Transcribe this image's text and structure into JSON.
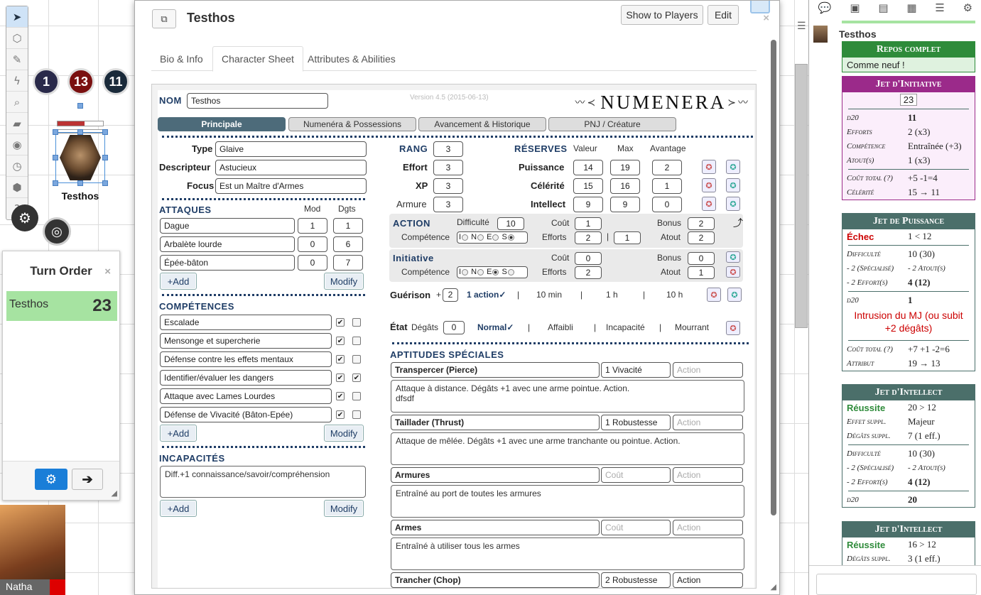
{
  "toolbar_icons": [
    "select-icon",
    "cube-icon",
    "brush-icon",
    "lightning-icon",
    "magnifier-icon",
    "ruler-icon",
    "eye-icon",
    "clock-icon",
    "d20-icon",
    "help-icon"
  ],
  "token": {
    "name": "Testhos",
    "badges": [
      "1",
      "13",
      "11"
    ],
    "badge_colors": [
      "#2a2a4a",
      "#7a1010",
      "#1a2a3a"
    ]
  },
  "turn_order": {
    "title": "Turn Order",
    "close": "×",
    "entries": [
      {
        "name": "Testhos",
        "value": "23"
      }
    ]
  },
  "player": {
    "name": "Natha"
  },
  "dialog": {
    "title": "Testhos",
    "show_players": "Show to Players",
    "edit": "Edit",
    "close": "×",
    "tabs": [
      "Bio & Info",
      "Character Sheet",
      "Attributes & Abilities"
    ]
  },
  "sheet": {
    "nom_label": "NOM",
    "nom_value": "Testhos",
    "version": "Version 4.5 (2015-06-13)",
    "logo": "NUMENERA",
    "subtabs": [
      "Principale",
      "Numenéra & Possessions",
      "Avancement & Historique",
      "PNJ / Créature"
    ],
    "type_label": "Type",
    "type_value": "Glaive",
    "desc_label": "Descripteur",
    "desc_value": "Astucieux",
    "focus_label": "Focus",
    "focus_value": "Est un Maître d'Armes",
    "rang_label": "RANG",
    "rang_value": "3",
    "effort_label": "Effort",
    "effort_value": "3",
    "xp_label": "XP",
    "xp_value": "3",
    "armure_label": "Armure",
    "armure_value": "3",
    "reserves_label": "RÉSERVES",
    "col_valeur": "Valeur",
    "col_max": "Max",
    "col_avantage": "Avantage",
    "pools": [
      {
        "name": "Puissance",
        "valeur": "14",
        "max": "19",
        "avantage": "2"
      },
      {
        "name": "Célérité",
        "valeur": "15",
        "max": "16",
        "avantage": "1"
      },
      {
        "name": "Intellect",
        "valeur": "9",
        "max": "9",
        "avantage": "0"
      }
    ],
    "attaques_label": "ATTAQUES",
    "mod_label": "Mod",
    "dgts_label": "Dgts",
    "attaques": [
      {
        "name": "Dague",
        "mod": "1",
        "dgts": "1"
      },
      {
        "name": "Arbalète lourde",
        "mod": "0",
        "dgts": "6"
      },
      {
        "name": "Épée-bâton",
        "mod": "0",
        "dgts": "7"
      }
    ],
    "add": "+Add",
    "modify": "Modify",
    "action": {
      "label": "ACTION",
      "difficulte_label": "Difficulté",
      "difficulte": "10",
      "cout_label": "Coût",
      "cout": "1",
      "bonus_label": "Bonus",
      "bonus": "2",
      "competence_label": "Compétence",
      "efforts_label": "Efforts",
      "efforts": "2",
      "efforts2": "1",
      "atout_label": "Atout",
      "atout": "2",
      "radio": [
        "I",
        "N",
        "E",
        "S"
      ]
    },
    "initiative": {
      "label": "Initiative",
      "cout_label": "Coût",
      "cout": "0",
      "bonus_label": "Bonus",
      "bonus": "0",
      "competence_label": "Compétence",
      "efforts_label": "Efforts",
      "efforts": "2",
      "atout_label": "Atout",
      "atout": "1",
      "radio": [
        "I",
        "N",
        "E",
        "S"
      ]
    },
    "guerison": {
      "label": "Guérison",
      "plus": "+",
      "value": "2",
      "options": [
        "1 action✓",
        "10 min",
        "1 h",
        "10 h"
      ]
    },
    "etat": {
      "label": "État",
      "degats_label": "Dégâts",
      "degats": "0",
      "options": [
        "Normal✓",
        "Affaibli",
        "Incapacité",
        "Mourrant"
      ]
    },
    "competences_label": "COMPÉTENCES",
    "competences": [
      {
        "name": "Escalade",
        "c1": "✔",
        "c2": ""
      },
      {
        "name": "Mensonge et supercherie",
        "c1": "✔",
        "c2": ""
      },
      {
        "name": "Défense contre les effets mentaux",
        "c1": "✔",
        "c2": ""
      },
      {
        "name": "Identifier/évaluer les dangers",
        "c1": "✔",
        "c2": "✔"
      },
      {
        "name": "Attaque avec Lames Lourdes",
        "c1": "✔",
        "c2": ""
      },
      {
        "name": "Défense de Vivacité (Bâton-Epée)",
        "c1": "✔",
        "c2": ""
      }
    ],
    "incapacites_label": "INCAPACITÉS",
    "incapacites": "Diff.+1 connaissance/savoir/compréhension",
    "aptitudes_label": "APTITUDES SPÉCIALES",
    "aptitudes": [
      {
        "name": "Transpercer (Pierce)",
        "cout": "1 Vivacité",
        "action": "",
        "desc": "Attaque à distance. Dégâts +1 avec une arme pointue. Action.\ndfsdf"
      },
      {
        "name": "Taillader (Thrust)",
        "cout": "1 Robustesse",
        "action": "",
        "desc": "Attaque de mêlée. Dégâts +1 avec une arme tranchante ou pointue. Action."
      },
      {
        "name": "Armures",
        "cout": "",
        "action": "",
        "desc": "Entraîné au port de toutes les armures"
      },
      {
        "name": "Armes",
        "cout": "",
        "action": "",
        "desc": "Entraîné à utiliser tous les armes"
      },
      {
        "name": "Trancher (Chop)",
        "cout": "2 Robustesse",
        "action": "Action",
        "desc": ""
      }
    ],
    "ph_cout": "Coût",
    "ph_action": "Action"
  },
  "chat": {
    "sender": "Testhos",
    "repos": {
      "title": "Repos complet",
      "text": "Comme neuf !",
      "color": "#2e8b3a"
    },
    "initiative": {
      "title": "Jet d'Initiative",
      "total": "23",
      "rows": [
        [
          "d20",
          "11"
        ],
        [
          "Efforts",
          "2 (x3)"
        ],
        [
          "Compétence",
          "Entraînée (+3)"
        ],
        [
          "Atout(s)",
          "1 (x3)"
        ]
      ],
      "rows2": [
        [
          "Coût total (?)",
          "+5 -1=4"
        ],
        [
          "Célérité",
          "15 → 11"
        ]
      ],
      "color": "#9b2a8a"
    },
    "puissance": {
      "title": "Jet de Puissance",
      "result": "Échec",
      "result_val": "1 < 12",
      "rows": [
        [
          "Difficulté",
          "10 (30)"
        ],
        [
          "- 2 (Spécialisé)",
          "- 2 Atout(s)"
        ],
        [
          "- 2 Effort(s)",
          "4 (12)"
        ]
      ],
      "d20": "1",
      "intrusion": "Intrusion du MJ (ou subit +2 dégâts)",
      "rows2": [
        [
          "Coût total (?)",
          "+7 +1 -2=6"
        ],
        [
          "Attribut",
          "19 → 13"
        ]
      ],
      "color": "#4b6f6a"
    },
    "intellect1": {
      "title": "Jet d'Intellect",
      "result": "Réussite",
      "result_val": "20 > 12",
      "rows": [
        [
          "Effet suppl.",
          "Majeur"
        ],
        [
          "Dégâts suppl.",
          "7 (1 eff.)"
        ]
      ],
      "rows2": [
        [
          "Difficulté",
          "10 (30)"
        ],
        [
          "- 2 (Spécialisé)",
          "- 2 Atout(s)"
        ],
        [
          "- 2 Effort(s)",
          "4 (12)"
        ]
      ],
      "d20": "20",
      "color": "#4b6f6a"
    },
    "intellect2": {
      "title": "Jet d'Intellect",
      "result": "Réussite",
      "result_val": "16 > 12",
      "rows": [
        [
          "Dégâts suppl.",
          "3 (1 eff.)"
        ]
      ],
      "color": "#4b6f6a"
    }
  }
}
